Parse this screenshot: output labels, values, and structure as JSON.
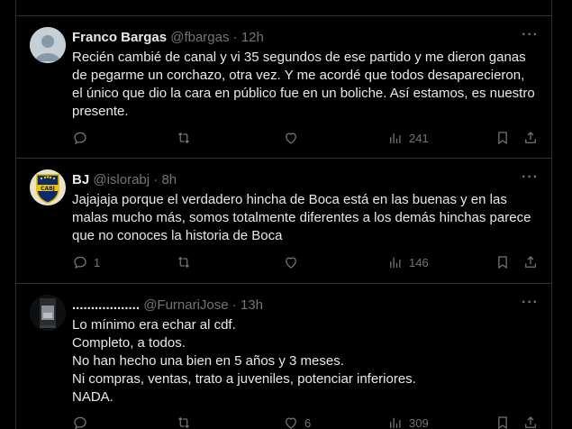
{
  "tweets": [
    {
      "name": "Franco Bargas",
      "handle": "@fbargas",
      "sep": "·",
      "time": "12h",
      "text": "Recién cambié de canal y vi 35 segundos de ese partido y me dieron ganas de pegarme un corchazo, otra vez. Y me acordé que todos desaparecieron, el único que dio la cara en público fue en un boliche. Así estamos, es nuestro presente.",
      "replies": "",
      "retweets": "",
      "likes": "",
      "views": "241",
      "avatar": "default-avatar"
    },
    {
      "name": "BJ",
      "handle": "@islorabj",
      "sep": "·",
      "time": "8h",
      "text": "Jajajaja porque el verdadero hincha de Boca está en las buenas y en las malas mucho más, somos totalmente diferentes a los demás hinchas parece que no conoces la historia de Boca",
      "replies": "1",
      "retweets": "",
      "likes": "",
      "views": "146",
      "avatar": "boca-crest-avatar",
      "avatar_text": "CABJ"
    },
    {
      "name": "..................",
      "handle": "@FurnariJose",
      "sep": "·",
      "time": "13h",
      "lines": [
        "Lo mínimo era echar al cdf.",
        "Completo, a todos.",
        "No han hecho una bien en 5 años y 3 meses.",
        "Ni compras, ventas, trato a juveniles, potenciar inferiores.",
        "NADA."
      ],
      "replies": "",
      "retweets": "",
      "likes": "6",
      "views": "309",
      "avatar": "photo-avatar"
    }
  ],
  "more_label": "···"
}
